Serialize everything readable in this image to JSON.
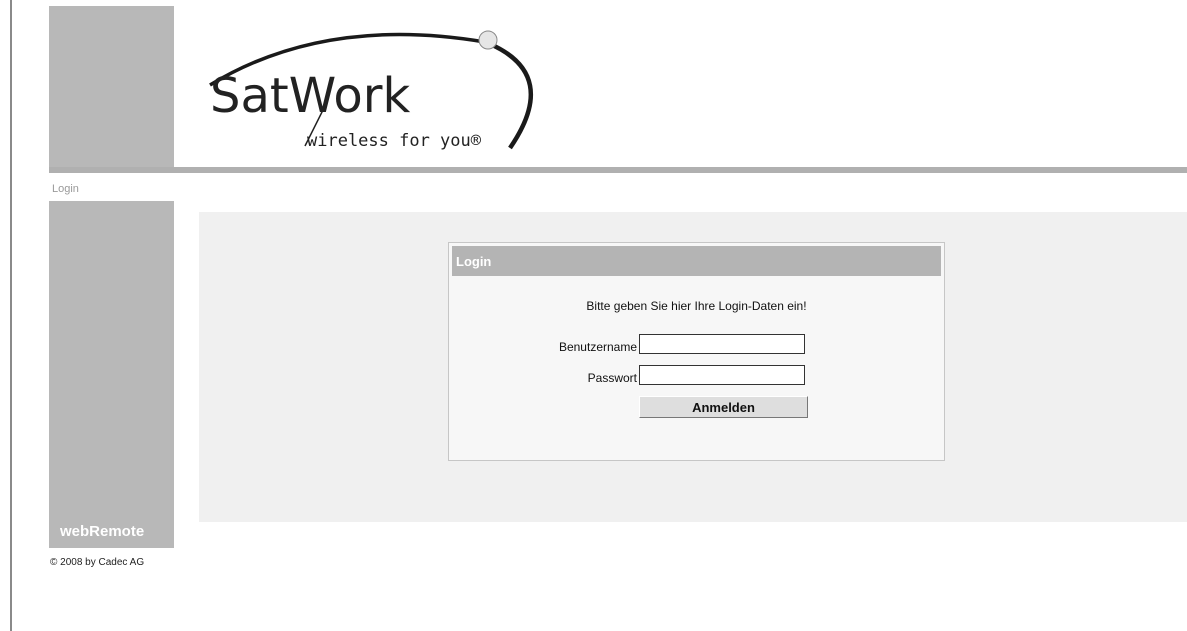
{
  "header": {
    "logo_name": "SatWork",
    "logo_tagline": "wireless for you®"
  },
  "breadcrumb": "Login",
  "sidebar": {
    "brand": "webRemote"
  },
  "footer": {
    "copyright": "© 2008 by Cadec AG"
  },
  "login": {
    "title": "Login",
    "instruction": "Bitte geben Sie hier Ihre Login-Daten ein!",
    "username_label": "Benutzername",
    "username_value": "",
    "password_label": "Passwort",
    "password_value": "",
    "submit_label": "Anmelden"
  }
}
